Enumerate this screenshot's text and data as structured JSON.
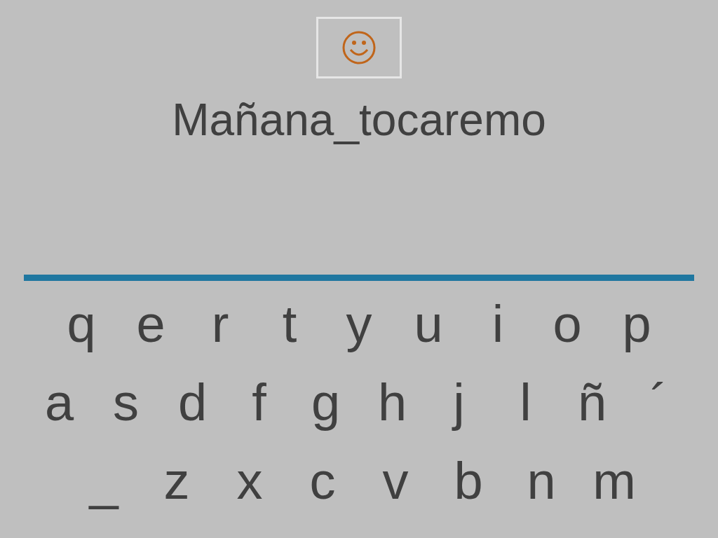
{
  "typed_text": "Mañana_tocaremo",
  "keyboard": {
    "rows": [
      [
        "q",
        "e",
        "r",
        "t",
        "y",
        "u",
        "i",
        "o",
        "p"
      ],
      [
        "a",
        "s",
        "d",
        "f",
        "g",
        "h",
        "j",
        "l",
        "ñ",
        "´"
      ],
      [
        "_",
        "z",
        "x",
        "c",
        "v",
        "b",
        "n",
        "m"
      ]
    ]
  }
}
